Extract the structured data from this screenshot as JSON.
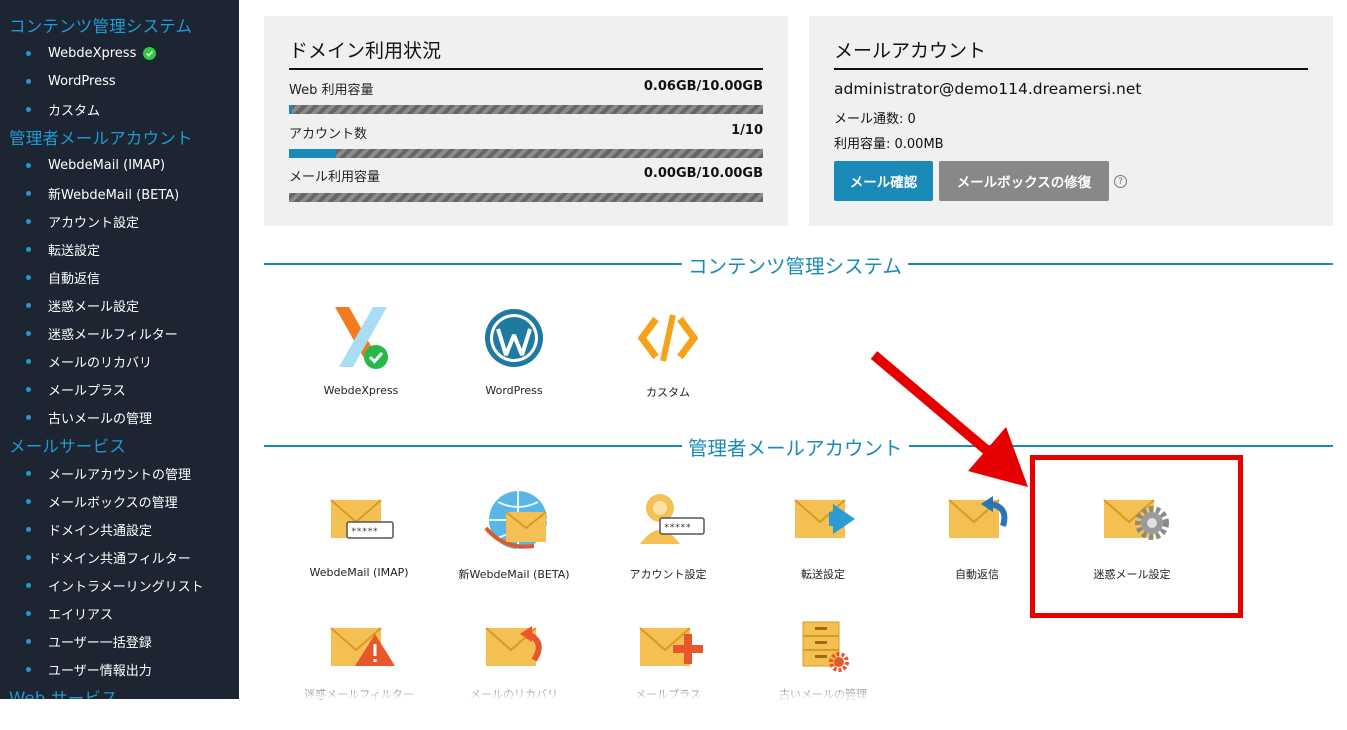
{
  "sidebar": {
    "cms_header": "コンテンツ管理システム",
    "cms_items": [
      "WebdeXpress",
      "WordPress",
      "カスタム"
    ],
    "admin_header": "管理者メールアカウント",
    "admin_items": [
      "WebdeMail (IMAP)",
      "新WebdeMail (BETA)",
      "アカウント設定",
      "転送設定",
      "自動返信",
      "迷惑メール設定",
      "迷惑メールフィルター",
      "メールのリカバリ",
      "メールプラス",
      "古いメールの管理"
    ],
    "mail_header": "メールサービス",
    "mail_items": [
      "メールアカウントの管理",
      "メールボックスの管理",
      "ドメイン共通設定",
      "ドメイン共通フィルター",
      "イントラメーリングリスト",
      "エイリアス",
      "ユーザー一括登録",
      "ユーザー情報出力"
    ],
    "web_header": "Web サービス"
  },
  "domain_usage": {
    "title": "ドメイン利用状況",
    "rows": [
      {
        "label": "Web 利用容量",
        "value": "0.06GB/10.00GB",
        "ratio": 0.006
      },
      {
        "label": "アカウント数",
        "value": "1/10",
        "ratio": 0.1
      },
      {
        "label": "メール利用容量",
        "value": "0.00GB/10.00GB",
        "ratio": 0.0
      }
    ]
  },
  "mail_account": {
    "title": "メールアカウント",
    "address": "administrator@demo114.dreamersi.net",
    "count_line": "メール通数: 0",
    "usage_line": "利用容量: 0.00MB",
    "check_button": "メール確認",
    "repair_button": "メールボックスの修復",
    "help_glyph": "?"
  },
  "sections": {
    "cms_title": "コンテンツ管理システム",
    "admin_title": "管理者メールアカウント"
  },
  "cms_tiles": [
    "WebdeXpress",
    "WordPress",
    "カスタム"
  ],
  "admin_tiles": [
    "WebdeMail (IMAP)",
    "新WebdeMail (BETA)",
    "アカウント設定",
    "転送設定",
    "自動返信",
    "迷惑メール設定",
    "迷惑メールフィルター",
    "メールのリカバリ",
    "メールプラス",
    "古いメールの管理"
  ],
  "password_mask": "*****",
  "colors": {
    "sidebar_bg": "#1c2531",
    "accent": "#1a8ab8",
    "check_button": "#1a8ab8",
    "repair_button": "#888888",
    "annotation": "#e60000",
    "envelope": "#f5c053"
  }
}
